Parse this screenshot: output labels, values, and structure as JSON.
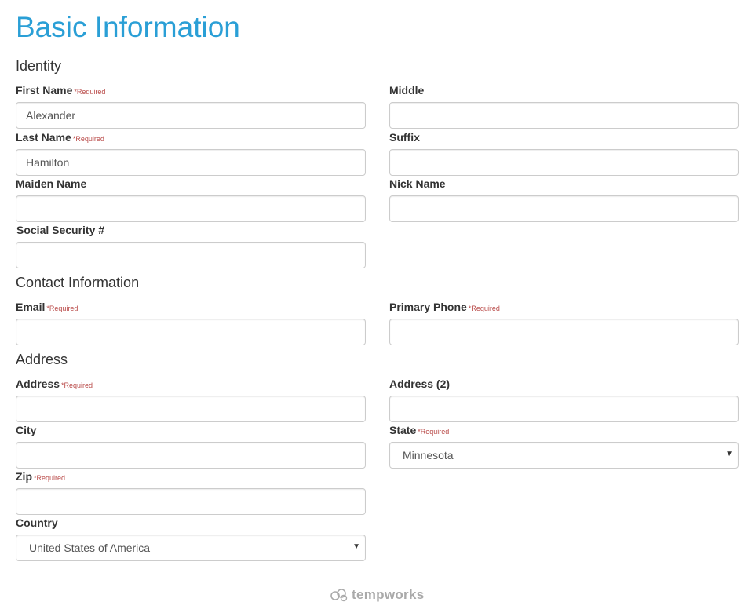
{
  "page": {
    "title": "Basic Information"
  },
  "required_marker": "*Required",
  "sections": {
    "identity": "Identity",
    "contact": "Contact Information",
    "address": "Address"
  },
  "identity": {
    "first_name": {
      "label": "First Name",
      "value": "Alexander"
    },
    "middle": {
      "label": "Middle",
      "value": ""
    },
    "last_name": {
      "label": "Last Name",
      "value": "Hamilton"
    },
    "suffix": {
      "label": "Suffix",
      "value": ""
    },
    "maiden_name": {
      "label": "Maiden Name",
      "value": ""
    },
    "nick_name": {
      "label": "Nick Name",
      "value": ""
    },
    "ssn": {
      "label": "Social Security #",
      "value": ""
    }
  },
  "contact": {
    "email": {
      "label": "Email",
      "value": ""
    },
    "primary_phone": {
      "label": "Primary Phone",
      "value": ""
    }
  },
  "address": {
    "address1": {
      "label": "Address",
      "value": ""
    },
    "address2": {
      "label": "Address (2)",
      "value": ""
    },
    "city": {
      "label": "City",
      "value": ""
    },
    "state": {
      "label": "State",
      "selected": "Minnesota"
    },
    "zip": {
      "label": "Zip",
      "value": ""
    },
    "country": {
      "label": "Country",
      "selected": "United States of America"
    }
  },
  "footer": {
    "logo_text": "tempworks"
  },
  "colors": {
    "title": "#2a9fd6",
    "required": "#b94a48",
    "border": "#cccccc",
    "logo": "#aaaaaa"
  },
  "icons": {
    "select_caret": "caret-down-icon",
    "logo": "tempworks-logo-icon"
  }
}
